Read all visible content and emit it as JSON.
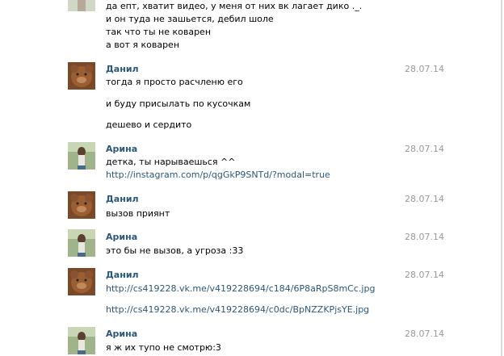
{
  "first_msg": {
    "lines": [
      "да епт, хватит видео, у меня от них вк лагает дико ._.",
      "и он туда не зашьется, дебил шоле",
      "так что ты не коварен",
      "а вот я коварен"
    ]
  },
  "messages": [
    {
      "author": "Данил",
      "date": "28.07.14",
      "lines": [
        "тогда я просто расчленю его",
        "и буду присылать по кусочкам",
        "дешево и сердито"
      ]
    },
    {
      "author": "Арина",
      "date": "28.07.14",
      "lines": [
        "детка, ты нарываешься ^^",
        "http://instagram.com/p/qgGkP9SNTd/?modal=true"
      ]
    },
    {
      "author": "Данил",
      "date": "28.07.14",
      "lines": [
        "вызов приянт"
      ]
    },
    {
      "author": "Арина",
      "date": "28.07.14",
      "lines": [
        "это бы не вызов, а угроза :33"
      ]
    },
    {
      "author": "Данил",
      "date": "28.07.14",
      "lines": [
        "http://cs419228.vk.me/v419228694/c184/6P8aRpS8mCc.jpg",
        "http://cs419228.vk.me/v419228694/c0dc/BpNZZKPjsYE.jpg"
      ]
    },
    {
      "author": "Арина",
      "date": "28.07.14",
      "lines": [
        "я ж их тупо не смотрю:3"
      ]
    }
  ],
  "colors": {
    "author": "#2b587a",
    "link": "#2b587a",
    "date": "#999999"
  }
}
